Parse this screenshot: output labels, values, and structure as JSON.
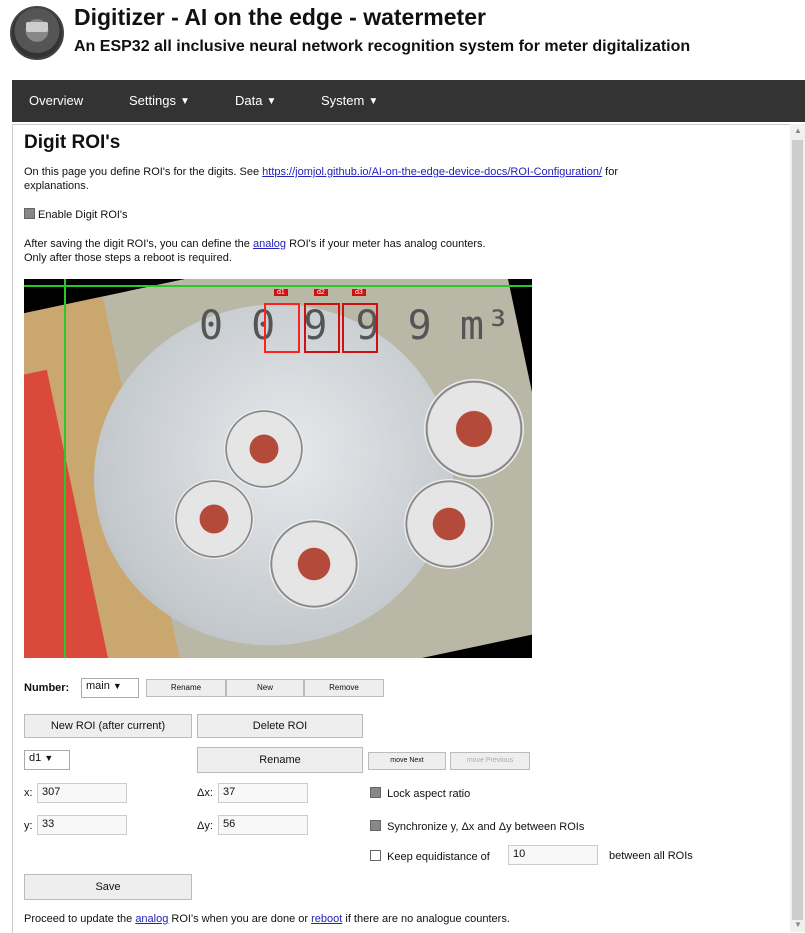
{
  "header": {
    "title": "Digitizer - AI on the edge - watermeter",
    "subtitle": "An ESP32 all inclusive neural network recognition system for meter digitalization"
  },
  "nav": {
    "overview": "Overview",
    "settings": "Settings",
    "data": "Data",
    "system": "System"
  },
  "page": {
    "title": "Digit ROI's",
    "intro_text": "On this page you define ROI's for the digits. See",
    "intro_link": "https://jomjol.github.io/AI-on-the-edge-device-docs/ROI-Configuration/",
    "intro_for": "for",
    "intro_explanations": "explanations.",
    "enable_label": "Enable Digit ROI's",
    "after_text1a": "After saving the digit ROI's, you can define the",
    "after_link": "analog",
    "after_text1b": "ROI's if your meter has analog counters.",
    "after_text2": "Only after those steps a reboot is required.",
    "image": {
      "digits": "0 0 9 9 9",
      "unit": "m³",
      "roi_labels": [
        "d1",
        "d2",
        "d3"
      ]
    },
    "number_label": "Number:",
    "number_select": "main",
    "rename_number": "Rename",
    "new_number": "New",
    "remove_number": "Remove",
    "new_roi": "New ROI (after current)",
    "delete_roi": "Delete ROI",
    "roi_select": "d1",
    "rename_roi": "Rename",
    "move_next": "move Next",
    "move_previous": "move Previous",
    "x_label": "x:",
    "x_value": "307",
    "dx_label": "Δx:",
    "dx_value": "37",
    "y_label": "y:",
    "y_value": "33",
    "dy_label": "Δy:",
    "dy_value": "56",
    "lock_aspect": "Lock aspect ratio",
    "sync_label": "Synchronize y, Δx and Δy between ROIs",
    "keep_label": "Keep equidistance of",
    "keep_value": "10",
    "keep_suffix": "between all ROIs",
    "save": "Save",
    "footer_a": "Proceed to update the",
    "footer_link1": "analog",
    "footer_b": "ROI's when you are done or",
    "footer_link2": "reboot",
    "footer_c": "if there are no analogue counters."
  }
}
